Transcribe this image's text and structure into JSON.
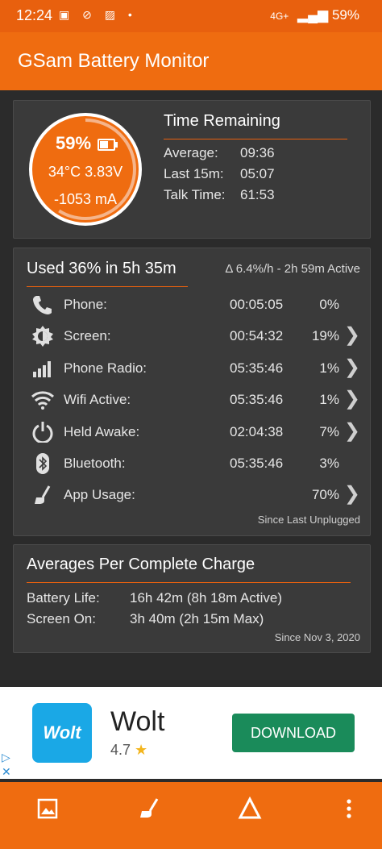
{
  "status_bar": {
    "time": "12:24",
    "battery": "59%",
    "network": "4G+"
  },
  "app": {
    "title": "GSam Battery Monitor"
  },
  "gauge": {
    "percent": "59%",
    "level": 0.59,
    "temp_voltage": "34°C  3.83V",
    "current": "-1053 mA",
    "color": "#ef6c10"
  },
  "time_remaining": {
    "title": "Time Remaining",
    "rows": [
      {
        "label": "Average:",
        "value": "09:36"
      },
      {
        "label": "Last 15m:",
        "value": "05:07"
      },
      {
        "label": "Talk Time:",
        "value": "61:53"
      }
    ]
  },
  "usage": {
    "title": "Used 36% in 5h 35m",
    "rate": "Δ 6.4%/h - 2h 59m Active",
    "rows": [
      {
        "label": "Phone:",
        "duration": "00:05:05",
        "percent": "0%",
        "icon": "phone-icon",
        "chevron": false
      },
      {
        "label": "Screen:",
        "duration": "00:54:32",
        "percent": "19%",
        "icon": "brightness-icon",
        "chevron": true
      },
      {
        "label": "Phone Radio:",
        "duration": "05:35:46",
        "percent": "1%",
        "icon": "signal-icon",
        "chevron": true
      },
      {
        "label": "Wifi Active:",
        "duration": "05:35:46",
        "percent": "1%",
        "icon": "wifi-icon",
        "chevron": true
      },
      {
        "label": "Held Awake:",
        "duration": "02:04:38",
        "percent": "7%",
        "icon": "power-icon",
        "chevron": true
      },
      {
        "label": "Bluetooth:",
        "duration": "05:35:46",
        "percent": "3%",
        "icon": "bluetooth-icon",
        "chevron": false
      },
      {
        "label": "App Usage:",
        "duration": "",
        "percent": "70%",
        "icon": "app-usage-icon",
        "chevron": true
      }
    ],
    "since": "Since Last Unplugged"
  },
  "averages": {
    "title": "Averages Per Complete Charge",
    "rows": [
      {
        "label": "Battery Life:",
        "value": "16h 42m (8h 18m Active)"
      },
      {
        "label": "Screen On:",
        "value": "3h 40m (2h 15m Max)"
      }
    ],
    "since": "Since Nov 3, 2020"
  },
  "ad": {
    "logo_text": "Wolt",
    "name": "Wolt",
    "rating": "4.7",
    "button": "DOWNLOAD"
  }
}
